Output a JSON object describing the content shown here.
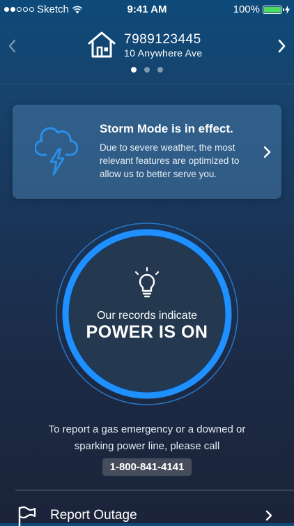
{
  "status_bar": {
    "carrier": "Sketch",
    "time": "9:41 AM",
    "battery_percent": "100%",
    "signal_bars_filled": 2,
    "signal_bars_total": 5,
    "battery_color": "#4cd964"
  },
  "account": {
    "number": "7989123445",
    "address": "10 Anywhere Ave",
    "page_count": 3,
    "active_page": 0,
    "icons": {
      "prev": "chevron-left-icon",
      "next": "chevron-right-icon",
      "home": "house-icon"
    }
  },
  "storm_card": {
    "title": "Storm Mode is in effect.",
    "body": "Due to severe weather, the most relevant features are optimized to allow us to better serve you.",
    "icon": "storm-cloud-icon",
    "accent_color": "#2a8fe8"
  },
  "power_status": {
    "subtitle": "Our records indicate",
    "status": "POWER IS ON",
    "icon": "lightbulb-icon",
    "ring_color": "#1e90ff"
  },
  "gas_emergency": {
    "text": "To report a gas emergency or a downed or sparking power line, please call",
    "phone": "1-800-841-4141"
  },
  "report_outage": {
    "label": "Report Outage",
    "icon": "flag-icon"
  }
}
